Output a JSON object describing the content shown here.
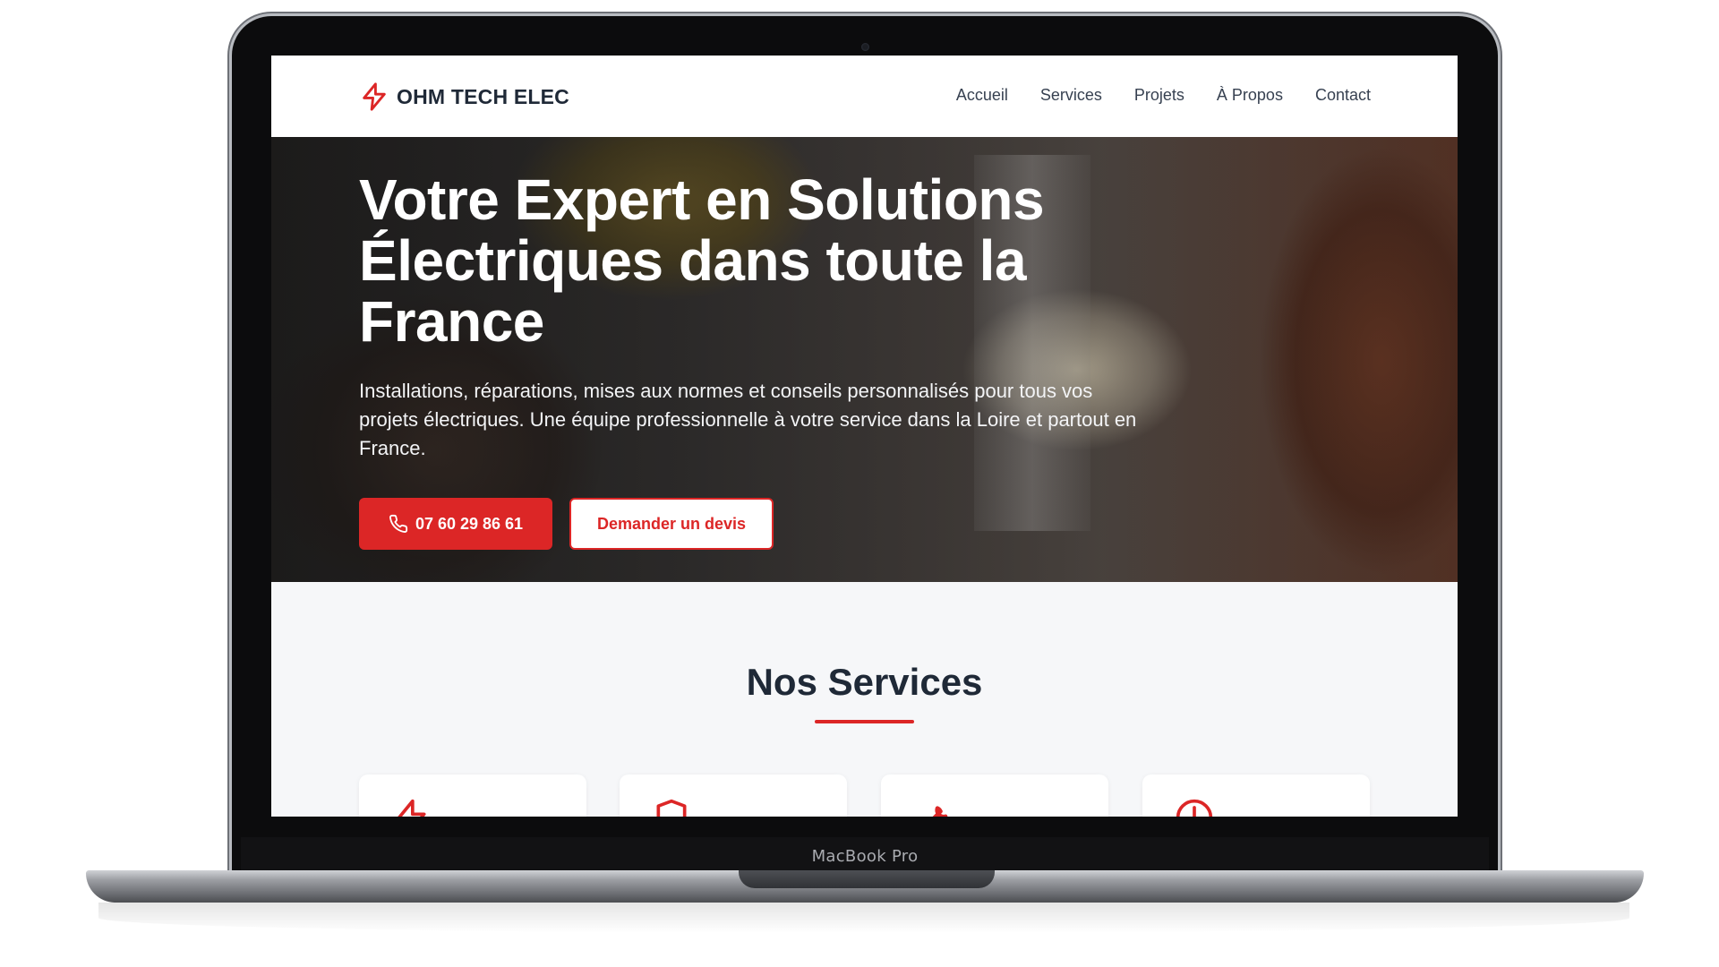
{
  "device": {
    "model_label": "MacBook Pro"
  },
  "site": {
    "brand": "OHM TECH ELEC",
    "nav": [
      {
        "label": "Accueil"
      },
      {
        "label": "Services"
      },
      {
        "label": "Projets"
      },
      {
        "label": "À Propos"
      },
      {
        "label": "Contact"
      }
    ]
  },
  "hero": {
    "title": "Votre Expert en Solutions Électriques dans toute la France",
    "subtitle": "Installations, réparations, mises aux normes et conseils personnalisés pour tous vos projets électriques. Une équipe professionnelle à votre service dans la Loire et partout en France.",
    "phone_button": "07 60 29 86 61",
    "quote_button": "Demander un devis"
  },
  "services": {
    "title": "Nos Services",
    "cards": [
      {
        "icon": "lightning-icon"
      },
      {
        "icon": "shield-icon"
      },
      {
        "icon": "wrench-icon"
      },
      {
        "icon": "clock-icon"
      }
    ]
  },
  "colors": {
    "accent": "#dc2626",
    "text_dark": "#1f2937",
    "section_bg": "#f6f7f9"
  }
}
